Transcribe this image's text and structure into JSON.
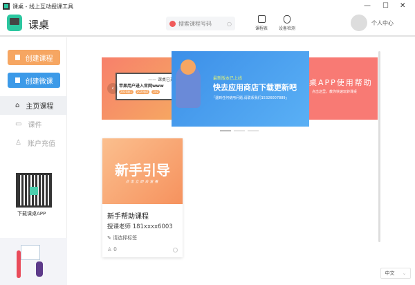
{
  "window": {
    "title": "课桌 - 线上互动授课工具",
    "min": "—",
    "max": "☐",
    "close": "✕"
  },
  "header": {
    "app_name": "课桌",
    "search_placeholder": "搜索课程号码",
    "schedule": "课程表",
    "device_check": "设备检测",
    "profile": "个人中心"
  },
  "sidebar": {
    "create_course": "创建课程",
    "create_micro": "创建微课",
    "nav": [
      {
        "label": "主页课程"
      },
      {
        "label": "课件"
      },
      {
        "label": "账户充值"
      }
    ],
    "qr_label": "下载课桌APP"
  },
  "banner": {
    "left": {
      "line1": "—— 课桌已开",
      "line2": "苹果用户进入官网www",
      "tags": [
        "2020副1",
        "2020副2",
        "202"
      ]
    },
    "center": {
      "kicker": "最新版本已上线",
      "headline": "快去应用商店下载更新吧",
      "sub": "「遇到任何使用问题,请联系我们15326007889」"
    },
    "right": {
      "headline": "桌APP使用帮助",
      "sub": "点击这里，教你快速玩转课桌"
    }
  },
  "card": {
    "cover_title": "新手引导",
    "cover_sub": "点击立即去查看",
    "title": "新手帮助课程",
    "teacher": "授课老师 181xxxx6003",
    "tag": "请选择标签",
    "count": "0"
  },
  "language": "中文",
  "colors": {
    "orange": "#f6a662",
    "blue": "#3c9ae8",
    "coral": "#f7806b",
    "accent": "#2cc7a0"
  }
}
